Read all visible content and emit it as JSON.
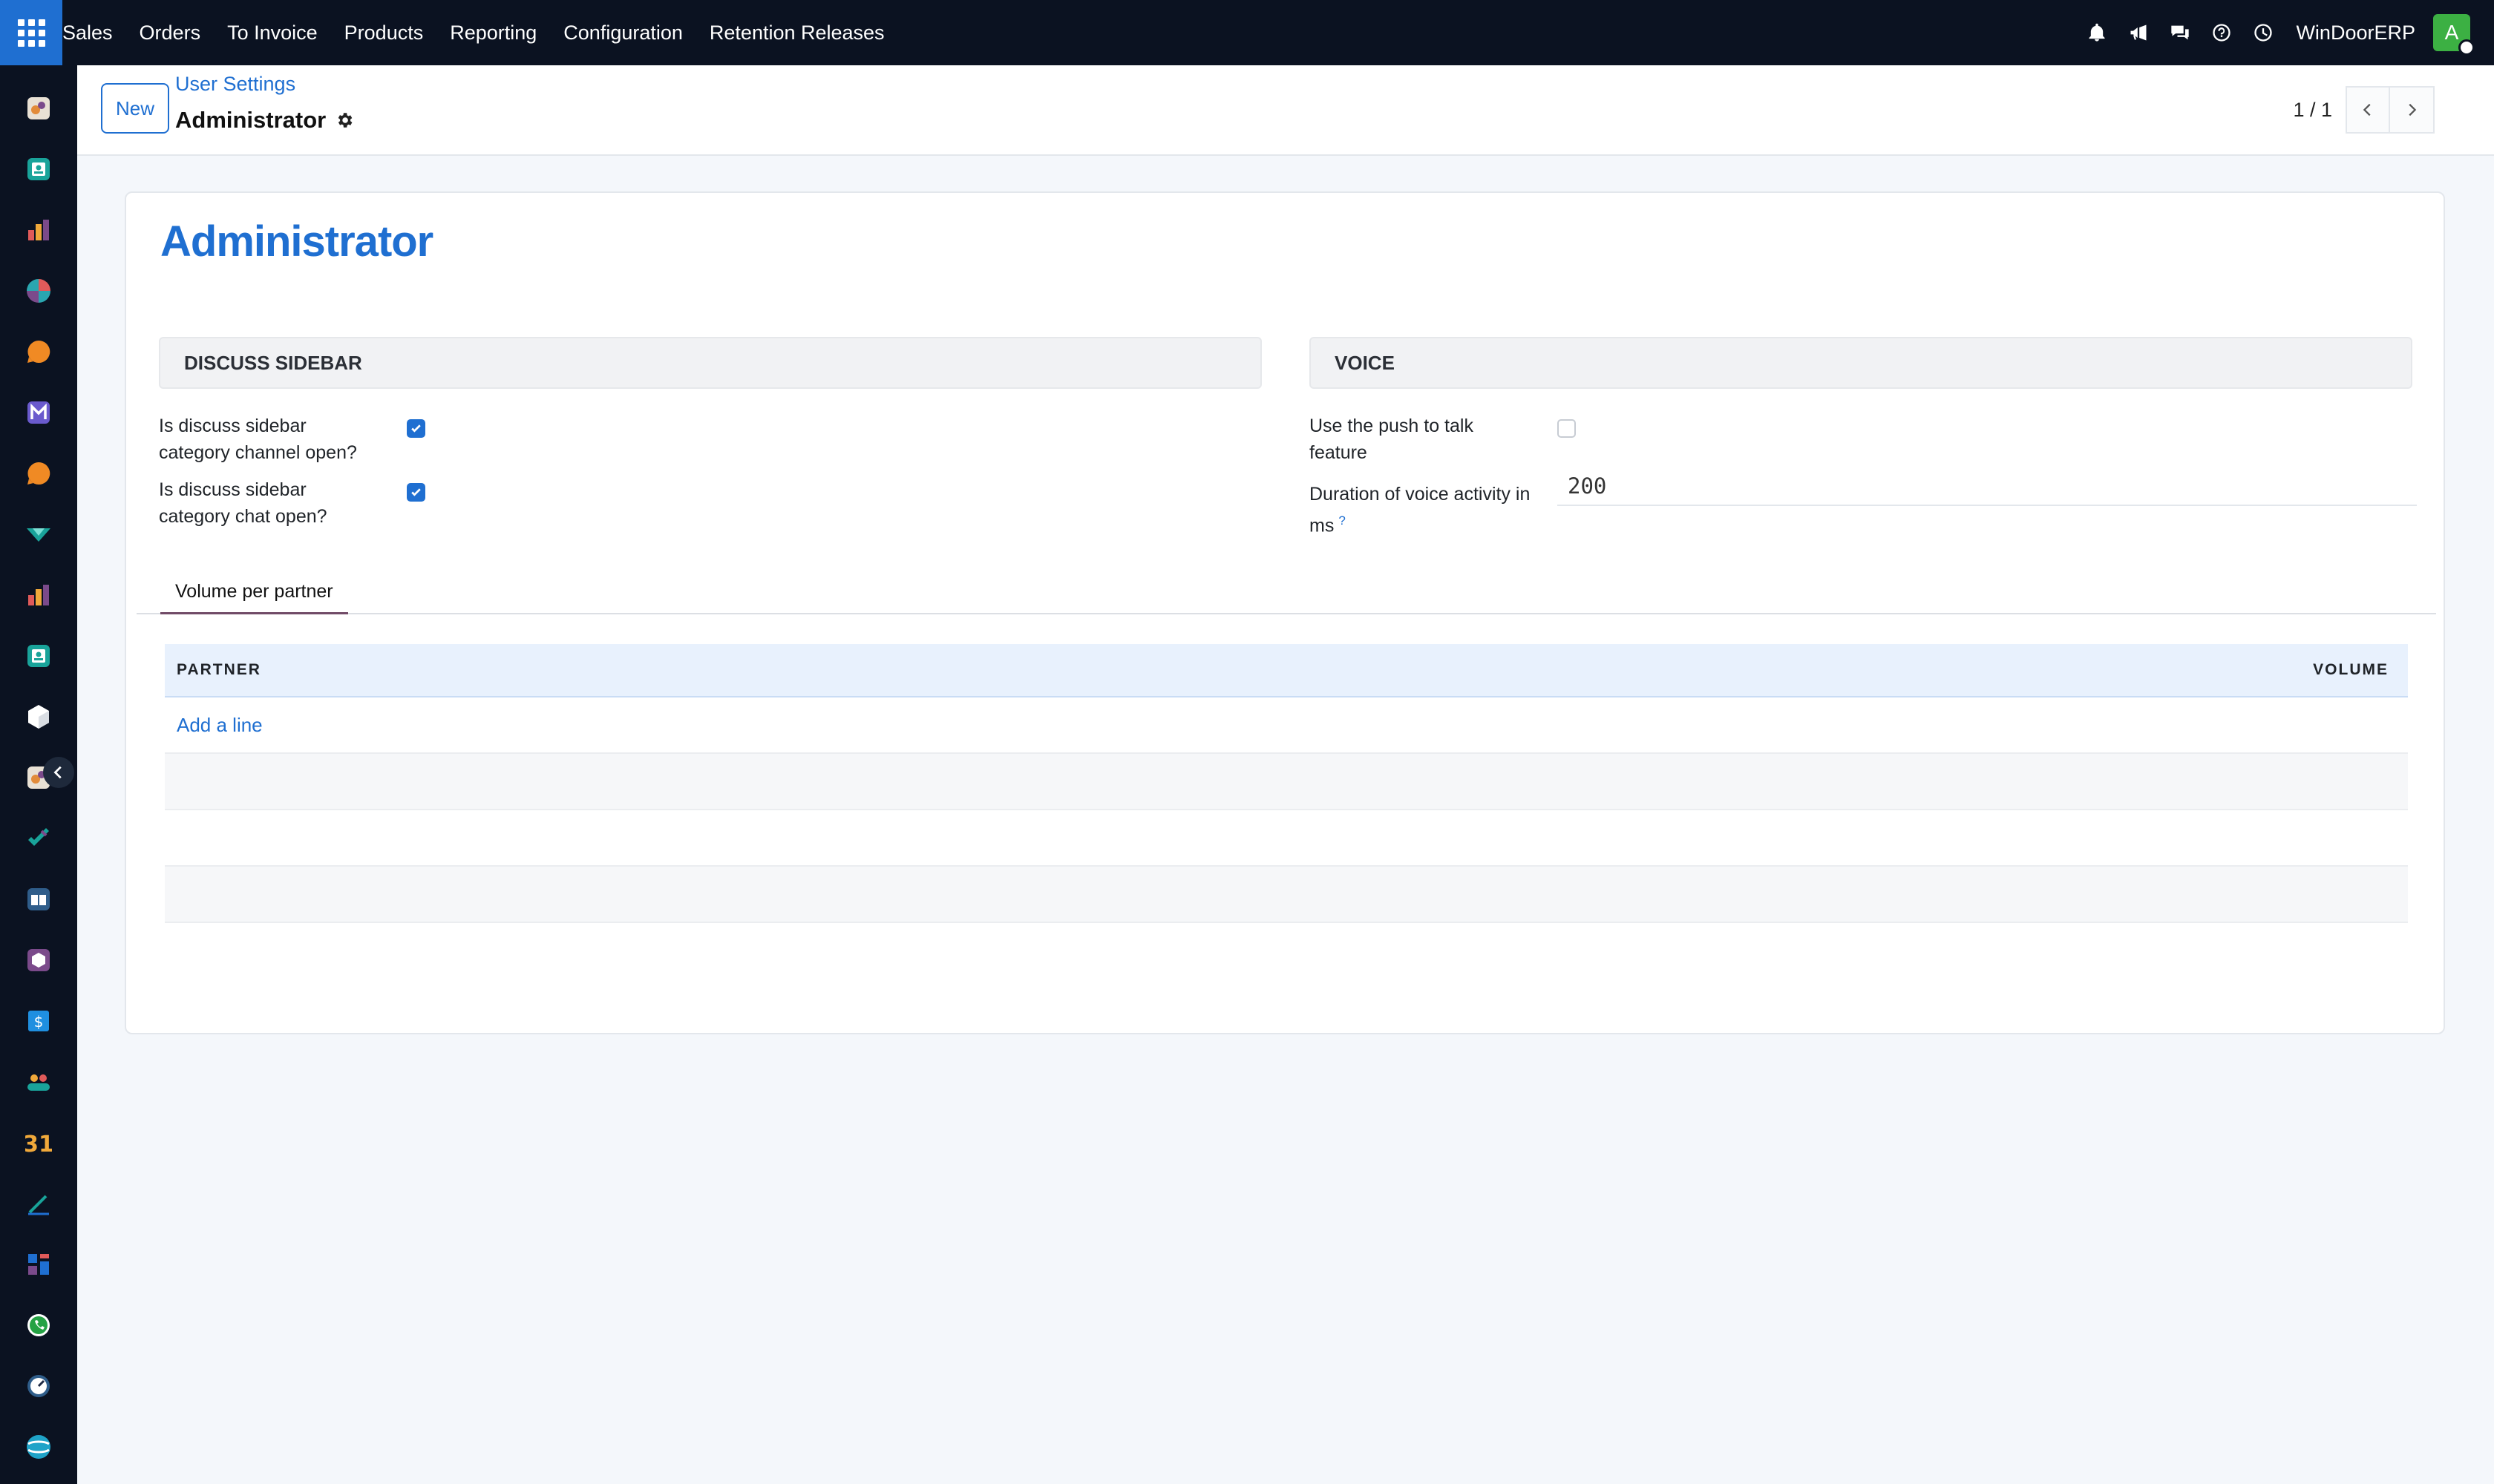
{
  "navbar": {
    "menu": [
      "Sales",
      "Orders",
      "To Invoice",
      "Products",
      "Reporting",
      "Configuration",
      "Retention Releases"
    ],
    "company": "WinDoorERP",
    "avatar_letter": "A",
    "icons": [
      "bell-icon",
      "megaphone-icon",
      "chat-icon",
      "help-icon",
      "clock-icon"
    ]
  },
  "sidebar": {
    "apps": [
      "app-icon-1",
      "app-icon-2",
      "app-icon-3",
      "app-icon-4",
      "app-icon-5",
      "app-icon-6",
      "app-icon-7",
      "app-icon-8",
      "app-icon-9",
      "app-icon-10",
      "app-icon-11",
      "app-icon-12",
      "app-icon-13",
      "app-icon-14",
      "app-icon-15",
      "app-icon-16",
      "app-icon-17",
      "calendar-31-icon",
      "app-icon-19",
      "app-icon-20",
      "whatsapp-icon",
      "app-icon-22",
      "app-icon-23"
    ],
    "calendar_text": "31"
  },
  "control": {
    "new_label": "New",
    "breadcrumb": "User Settings",
    "title": "Administrator",
    "pager": "1 / 1"
  },
  "form": {
    "name": "Administrator",
    "discuss_header": "DISCUSS SIDEBAR",
    "voice_header": "VOICE",
    "channel_open_label": "Is discuss sidebar category channel open?",
    "channel_open_value": true,
    "chat_open_label": "Is discuss sidebar category chat open?",
    "chat_open_value": true,
    "push_to_talk_label": "Use the push to talk feature",
    "push_to_talk_value": false,
    "voice_duration_label": "Duration of voice activity in ms",
    "voice_duration_help": "?",
    "voice_duration_value": "200",
    "tab_label": "Volume per partner",
    "table": {
      "columns": [
        "PARTNER",
        "VOLUME"
      ],
      "add_line": "Add a line"
    }
  },
  "colors": {
    "primary": "#1f6fd1",
    "navbar": "#0b1221",
    "avatar": "#3cb043",
    "tab_underline": "#714b67"
  }
}
